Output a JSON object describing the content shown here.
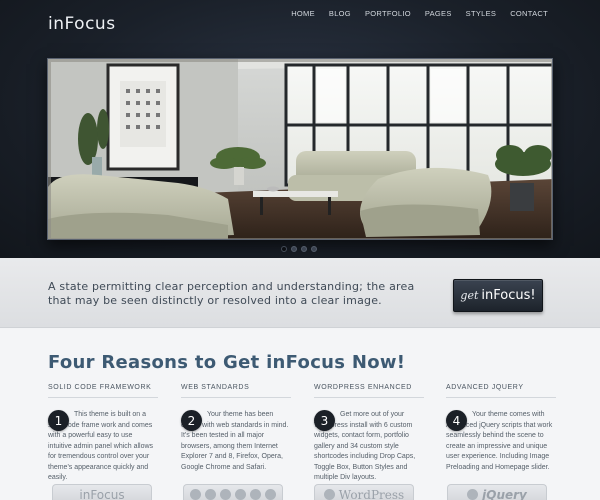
{
  "header": {
    "logo": "inFocus",
    "nav": [
      {
        "label": "HOME"
      },
      {
        "label": "BLOG"
      },
      {
        "label": "PORTFOLIO"
      },
      {
        "label": "PAGES"
      },
      {
        "label": "STYLES"
      },
      {
        "label": "CONTACT"
      }
    ]
  },
  "slider": {
    "image": "interior-living-room-photo",
    "dots": 4,
    "active_dot": 1
  },
  "band": {
    "tagline": "A state permitting clear perception and understanding; the area that may be seen distinctly or resolved into a clear image.",
    "cta_prefix": "get",
    "cta_brand": "inFocus!"
  },
  "reasons": {
    "title": "Four Reasons to Get inFocus Now!",
    "columns": [
      {
        "heading": "SOLID CODE FRAMEWORK",
        "number": "1",
        "text": "This theme is built on a solid code frame work and comes with a powerful easy to use intuitive admin panel which allows for tremendous control over your theme's appearance quickly and easily.",
        "badge": "inFocus"
      },
      {
        "heading": "WEB STANDARDS",
        "number": "2",
        "text": "Your theme has been coded with web standards in mind. It's been tested in all major browsers, among them Internet Explorer 7 and 8, Firefox, Opera, Google Chrome and Safari.",
        "badge": ""
      },
      {
        "heading": "WORDPRESS ENHANCED",
        "number": "3",
        "text": "Get more out of your Wordpress install with 6 custom widgets, contact form, portfolio gallery and 34 custom style shortcodes including Drop Caps, Toggle Box, Button Styles and multiple Div layouts.",
        "badge": "WordPress"
      },
      {
        "heading": "ADVANCED JQUERY",
        "number": "4",
        "text": "Your theme comes with Advanced jQuery scripts that work seamlessly behind the scene to create an impressive and unique user experience. Including Image Preloading and Homepage slider.",
        "badge": "jQuery"
      }
    ]
  }
}
